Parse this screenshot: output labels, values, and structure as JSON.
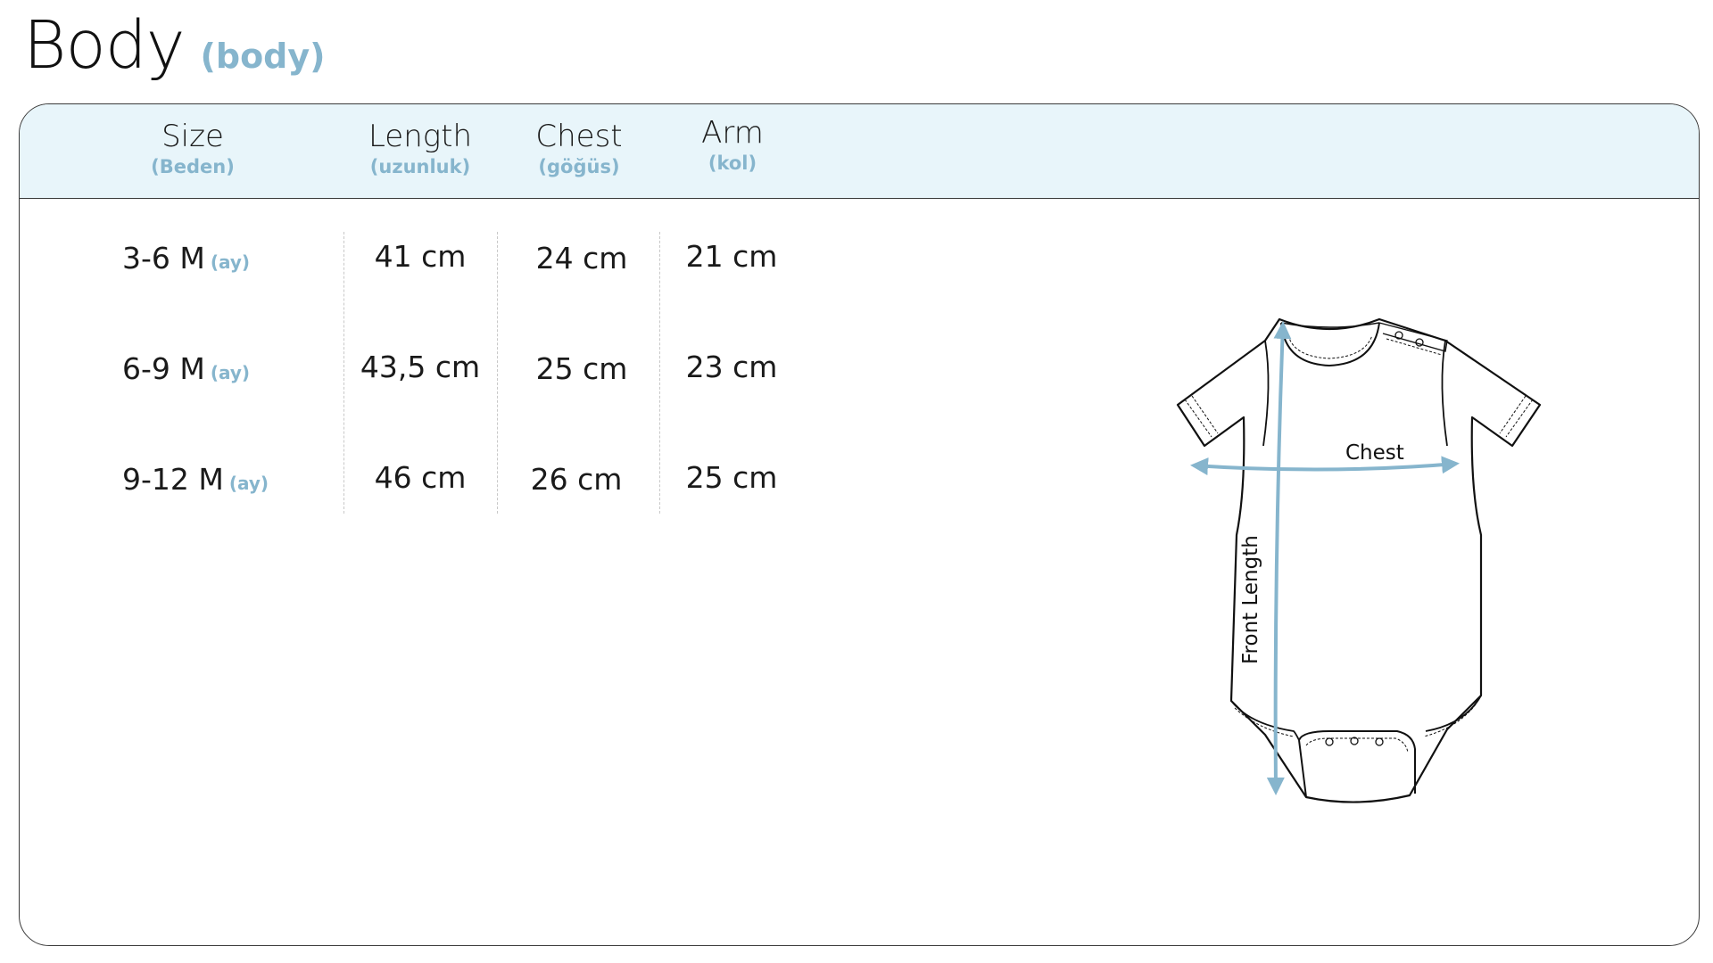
{
  "title": {
    "main": "Body",
    "sub": "(body)"
  },
  "table": {
    "headers": [
      {
        "label": "Size",
        "sub": "(Beden)"
      },
      {
        "label": "Length",
        "sub": "(uzunluk)"
      },
      {
        "label": "Chest",
        "sub": "(göğüs)"
      },
      {
        "label": "Arm",
        "sub": "(kol)"
      }
    ],
    "rows": [
      {
        "size": "3-6 M",
        "unit": "(ay)",
        "length": "41 cm",
        "chest": "24 cm",
        "arm": "21 cm"
      },
      {
        "size": "6-9 M",
        "unit": "(ay)",
        "length": "43,5 cm",
        "chest": "25 cm",
        "arm": "23 cm"
      },
      {
        "size": "9-12 M",
        "unit": "(ay)",
        "length": "46 cm",
        "chest": "26 cm",
        "arm": "25 cm"
      }
    ]
  },
  "diagram": {
    "chest_label": "Chest",
    "length_label": "Front Length",
    "accent_color": "#86b5cd"
  }
}
